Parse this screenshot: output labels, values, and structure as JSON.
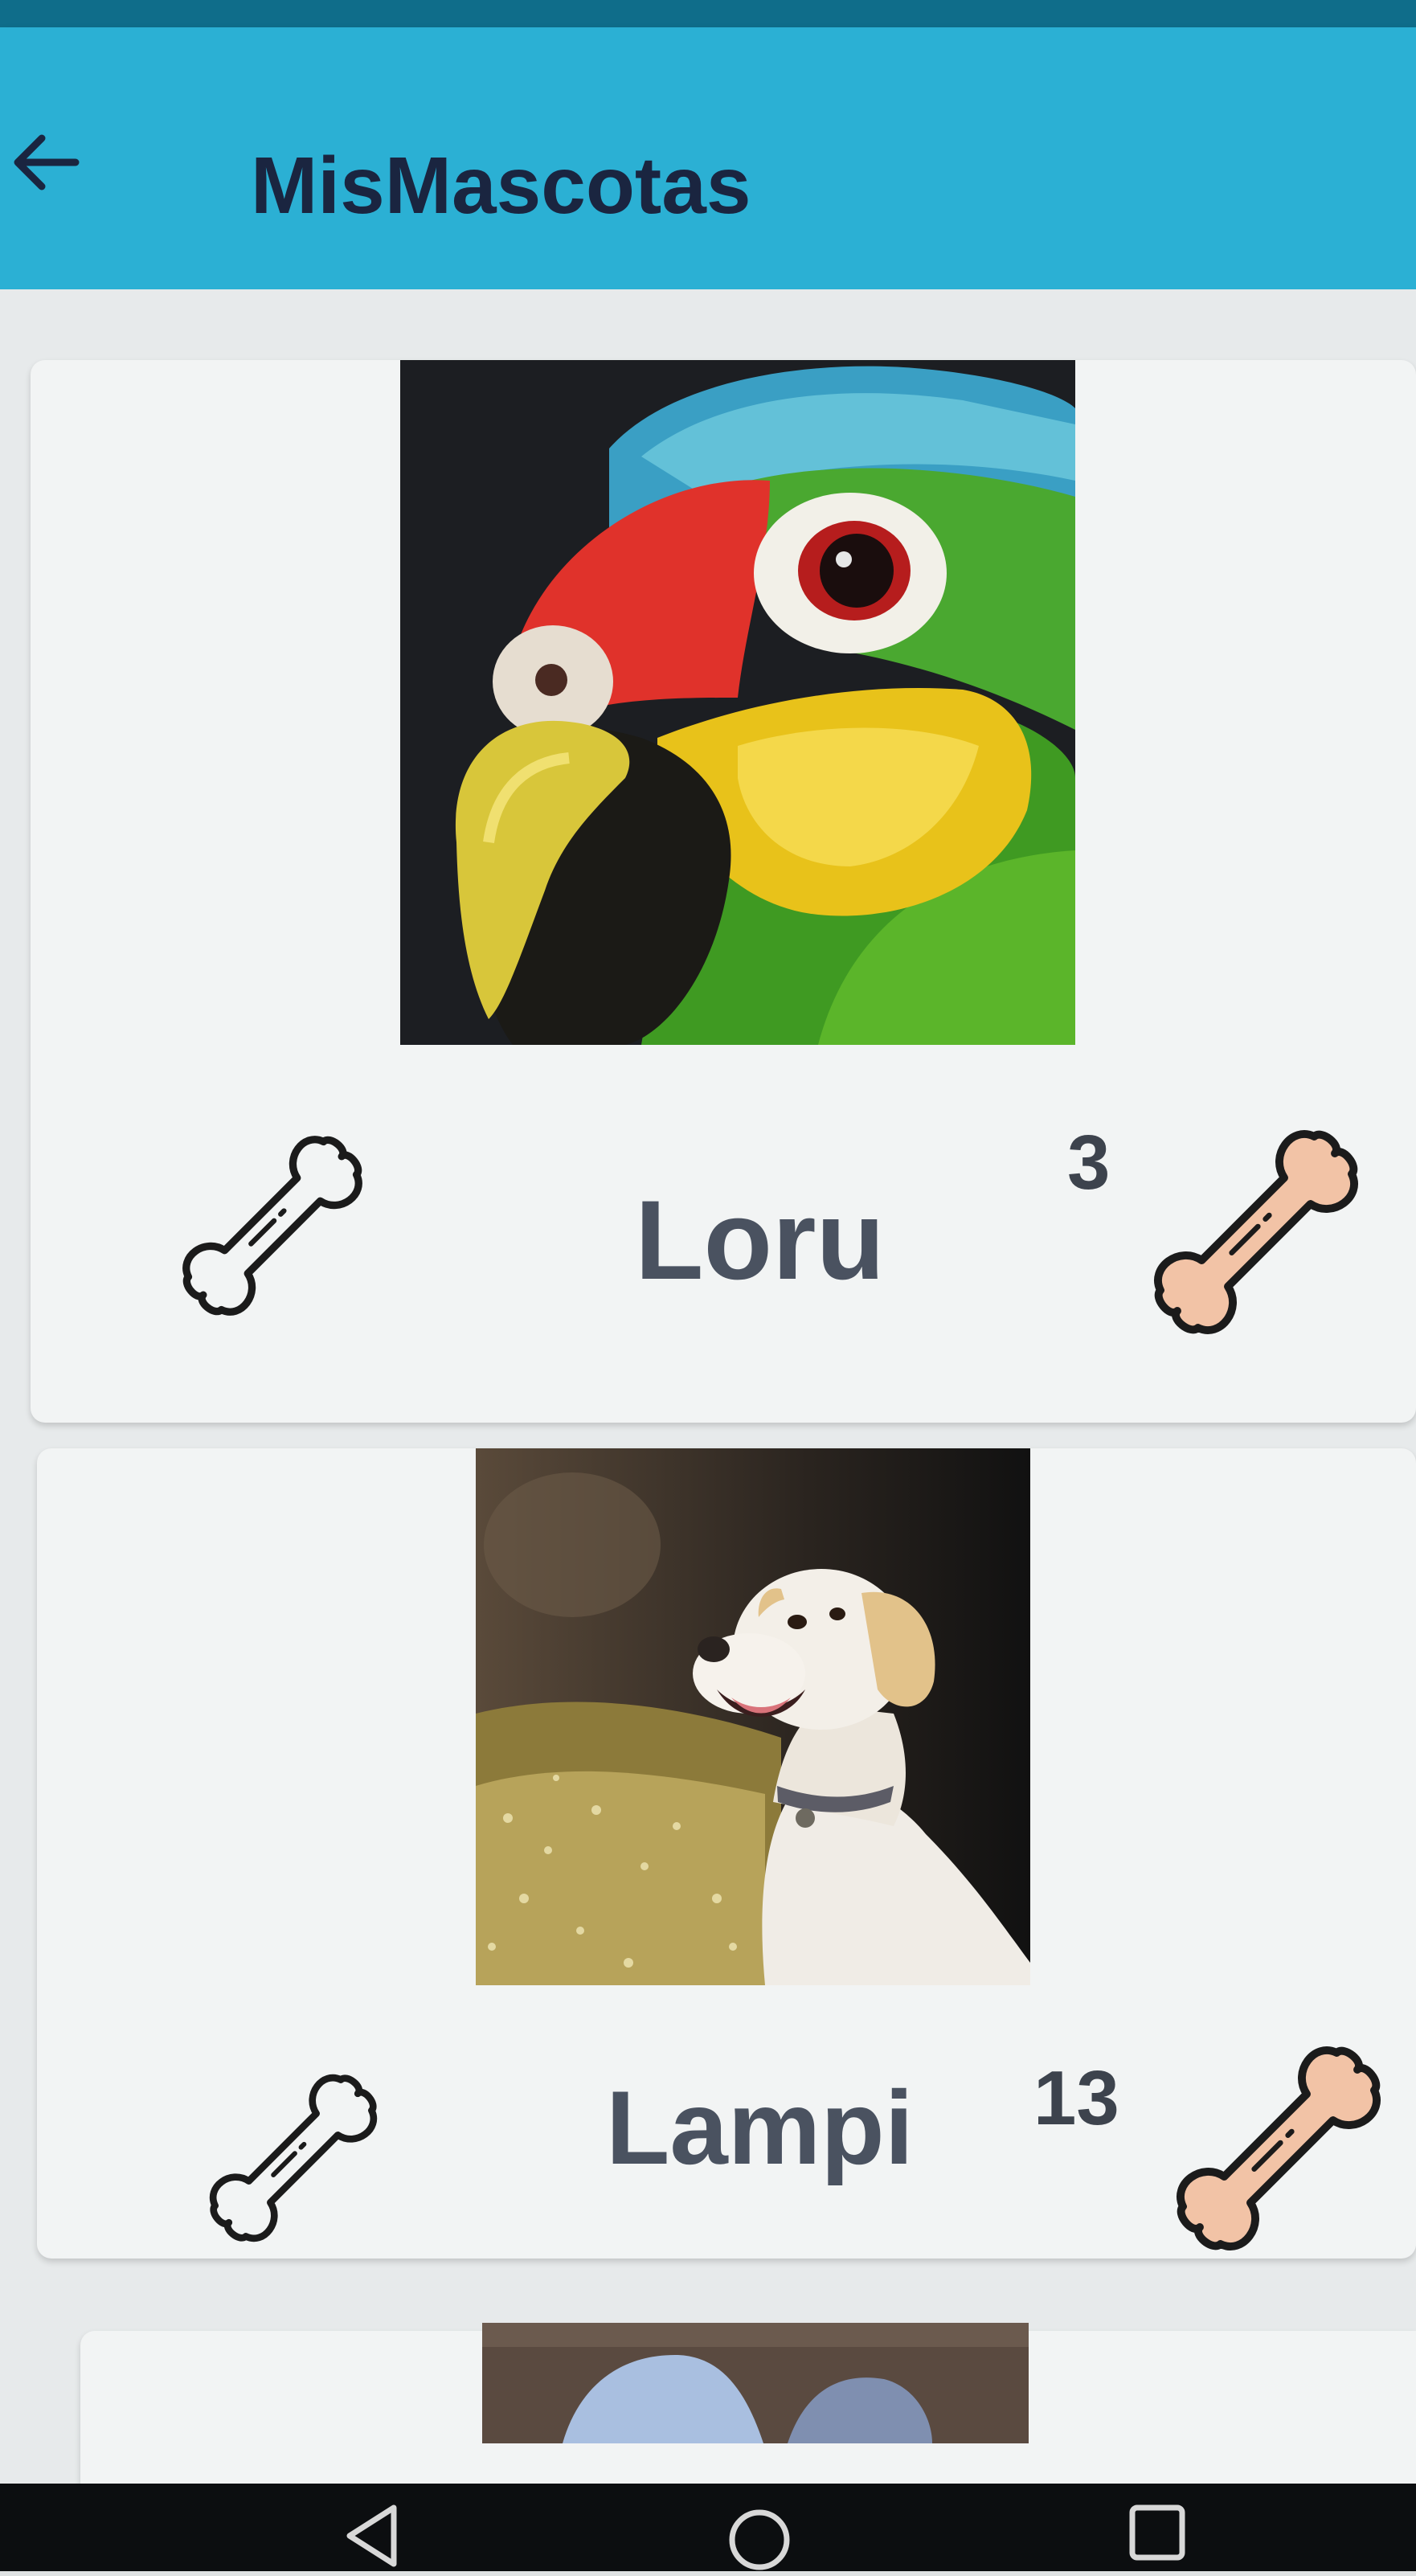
{
  "app": {
    "title": "MisMascotas"
  },
  "icons": {
    "back": "arrow-left-icon",
    "rate": "bone-outline-icon",
    "likes": "bone-filled-icon",
    "nav_back": "triangle-back-icon",
    "nav_home": "circle-home-icon",
    "nav_recents": "square-recents-icon"
  },
  "colors": {
    "appbar": "#2bb0d4",
    "title_text": "#1a2540",
    "bone_fill": "#f2c3a6",
    "name_text": "#4a5260"
  },
  "pets": [
    {
      "name": "Loru",
      "likes": "3",
      "animal": "parrot"
    },
    {
      "name": "Lampi",
      "likes": "13",
      "animal": "dog"
    },
    {
      "name": "",
      "likes": "",
      "animal": "partial"
    }
  ]
}
